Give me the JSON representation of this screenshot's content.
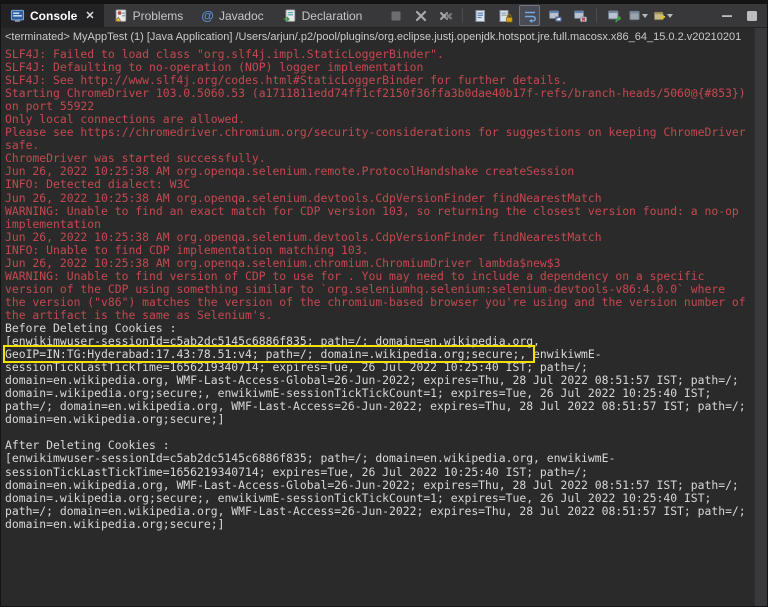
{
  "tabs": [
    {
      "label": "Console",
      "icon": "console-icon",
      "active": true,
      "close_glyph": "✕"
    },
    {
      "label": "Problems",
      "icon": "problems-icon"
    },
    {
      "label": "Javadoc",
      "icon": "javadoc-at-icon",
      "glyph": "@"
    },
    {
      "label": "Declaration",
      "icon": "declaration-icon"
    }
  ],
  "toolbar": {
    "buttons": [
      {
        "name": "terminate",
        "title": "Terminate"
      },
      {
        "name": "remove-launch",
        "title": "Remove Launch"
      },
      {
        "name": "remove-all-terminated",
        "title": "Remove All Terminated Launches"
      },
      {
        "name": "clear-console",
        "title": "Clear Console"
      },
      {
        "name": "scroll-lock",
        "title": "Scroll Lock"
      },
      {
        "name": "word-wrap",
        "title": "Word Wrap",
        "active": true
      },
      {
        "name": "show-stdout-changed",
        "title": "Show Console When Standard Out Changes"
      },
      {
        "name": "show-stderr-changed",
        "title": "Show Console When Standard Error Changes"
      },
      {
        "name": "pin-console",
        "title": "Pin Console"
      },
      {
        "name": "display-selected-console",
        "title": "Display Selected Console"
      },
      {
        "name": "open-console",
        "title": "Open Console"
      },
      {
        "name": "minimize",
        "title": "Minimize"
      },
      {
        "name": "maximize",
        "title": "Maximize"
      }
    ]
  },
  "console": {
    "header": "<terminated> MyAppTest (1) [Java Application] /Users/arjun/.p2/pool/plugins/org.eclipse.justj.openjdk.hotspot.jre.full.macosx.x86_64_15.0.2.v20210201",
    "lines": [
      {
        "type": "stderr",
        "text": "SLF4J: Failed to load class \"org.slf4j.impl.StaticLoggerBinder\"."
      },
      {
        "type": "stderr",
        "text": "SLF4J: Defaulting to no-operation (NOP) logger implementation"
      },
      {
        "type": "stderr",
        "text": "SLF4J: See http://www.slf4j.org/codes.html#StaticLoggerBinder for further details."
      },
      {
        "type": "stderr",
        "text": "Starting ChromeDriver 103.0.5060.53 (a1711811edd74ff1cf2150f36ffa3b0dae40b17f-refs/branch-heads/5060@{#853}) on port 55922"
      },
      {
        "type": "stderr",
        "text": "Only local connections are allowed."
      },
      {
        "type": "stderr",
        "text": "Please see https://chromedriver.chromium.org/security-considerations for suggestions on keeping ChromeDriver safe."
      },
      {
        "type": "stderr",
        "text": "ChromeDriver was started successfully."
      },
      {
        "type": "stderr",
        "text": "Jun 26, 2022 10:25:38 AM org.openqa.selenium.remote.ProtocolHandshake createSession"
      },
      {
        "type": "stderr",
        "text": "INFO: Detected dialect: W3C"
      },
      {
        "type": "stderr",
        "text": "Jun 26, 2022 10:25:38 AM org.openqa.selenium.devtools.CdpVersionFinder findNearestMatch"
      },
      {
        "type": "stderr",
        "text": "WARNING: Unable to find an exact match for CDP version 103, so returning the closest version found: a no-op implementation"
      },
      {
        "type": "stderr",
        "text": "Jun 26, 2022 10:25:38 AM org.openqa.selenium.devtools.CdpVersionFinder findNearestMatch"
      },
      {
        "type": "stderr",
        "text": "INFO: Unable to find CDP implementation matching 103."
      },
      {
        "type": "stderr",
        "text": "Jun 26, 2022 10:25:38 AM org.openqa.selenium.chromium.ChromiumDriver lambda$new$3"
      },
      {
        "type": "stderr",
        "text": "WARNING: Unable to find version of CDP to use for . You may need to include a dependency on a specific version of the CDP using something similar to `org.seleniumhq.selenium:selenium-devtools-v86:4.0.0` where the version (\"v86\") matches the version of the chromium-based browser you're using and the version number of the artifact is the same as Selenium's."
      },
      {
        "type": "stdout",
        "text": "Before Deleting Cookies :"
      },
      {
        "type": "stdout",
        "segments": [
          {
            "text": "[enwikimwuser-sessionId=c5ab2dc5145c6886f835; path=/; domain=en.wikipedia.org, ",
            "highlight": false
          },
          {
            "text": "GeoIP=IN:TG:Hyderabad:17.43:78.51:v4; path=/; domain=.wikipedia.org;secure;, ",
            "highlight": true
          },
          {
            "text": "enwikiwmE-sessionTickLastTickTime=1656219340714; expires=Tue, 26 Jul 2022 10:25:40 IST; path=/; domain=en.wikipedia.org, WMF-Last-Access-Global=26-Jun-2022; expires=Thu, 28 Jul 2022 08:51:57 IST; path=/; domain=.wikipedia.org;secure;, enwikiwmE-sessionTickTickCount=1; expires=Tue, 26 Jul 2022 10:25:40 IST; path=/; domain=en.wikipedia.org, WMF-Last-Access=26-Jun-2022; expires=Thu, 28 Jul 2022 08:51:57 IST; path=/; domain=en.wikipedia.org;secure;]",
            "highlight": false
          }
        ]
      },
      {
        "type": "stdout",
        "text": ""
      },
      {
        "type": "stdout",
        "text": "After Deleting Cookies :"
      },
      {
        "type": "stdout",
        "text": "[enwikimwuser-sessionId=c5ab2dc5145c6886f835; path=/; domain=en.wikipedia.org, enwikiwmE-sessionTickLastTickTime=1656219340714; expires=Tue, 26 Jul 2022 10:25:40 IST; path=/; domain=en.wikipedia.org, WMF-Last-Access-Global=26-Jun-2022; expires=Thu, 28 Jul 2022 08:51:57 IST; path=/; domain=.wikipedia.org;secure;, enwikiwmE-sessionTickTickCount=1; expires=Tue, 26 Jul 2022 10:25:40 IST; path=/; domain=en.wikipedia.org, WMF-Last-Access=26-Jun-2022; expires=Thu, 28 Jul 2022 08:51:57 IST; path=/; domain=en.wikipedia.org;secure;]"
      }
    ]
  },
  "colors": {
    "stderr_text": "#C3494F",
    "stdout_text": "#D8D8D8",
    "highlight_border": "#F2E104",
    "console_bg": "#2A2A2B",
    "tabbar_bg": "#38383A",
    "active_tab_bg": "#222224"
  }
}
